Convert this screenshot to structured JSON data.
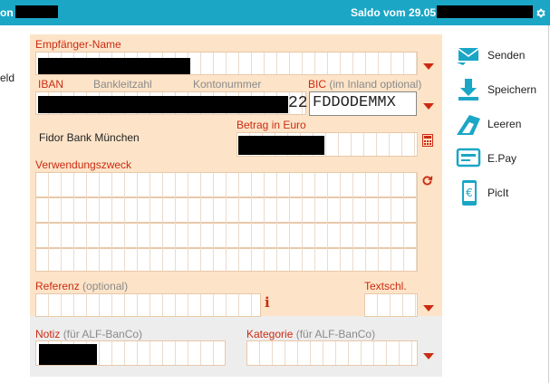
{
  "header": {
    "left_text": "on",
    "saldo_text": "Saldo vom 29.05",
    "settings_icon": "gear-icon"
  },
  "side": {
    "cut_label": "eld"
  },
  "form": {
    "empfaenger_label": "Empfänger-Name",
    "iban_label": "IBAN",
    "blz_label": "Bankleitzahl",
    "konto_label": "Kontonummer",
    "bic_label": "BIC",
    "bic_hint": "(im Inland optional)",
    "iban_tail": "22",
    "bic_value": "FDDODEMMX",
    "bank_name": "Fidor Bank München",
    "betrag_label": "Betrag in Euro",
    "verwendung_label": "Verwendungszweck",
    "referenz_label": "Referenz",
    "referenz_hint": "(optional)",
    "textschl_label": "Textschl.",
    "notiz_label": "Notiz",
    "notiz_hint": "(für ALF-BanCo)",
    "kategorie_label": "Kategorie",
    "kategorie_hint": "(für ALF-BanCo)"
  },
  "actions": [
    {
      "label": "Senden",
      "icon": "send-icon"
    },
    {
      "label": "Speichern",
      "icon": "download-icon"
    },
    {
      "label": "Leeren",
      "icon": "eraser-icon"
    },
    {
      "label": "E.Pay",
      "icon": "epay-icon"
    },
    {
      "label": "PicIt",
      "icon": "phone-euro-icon"
    }
  ],
  "colors": {
    "accent": "#1ba6c6",
    "form_bg": "#fde4c8",
    "label_red": "#cc2b12",
    "notes_bg": "#ededed"
  }
}
